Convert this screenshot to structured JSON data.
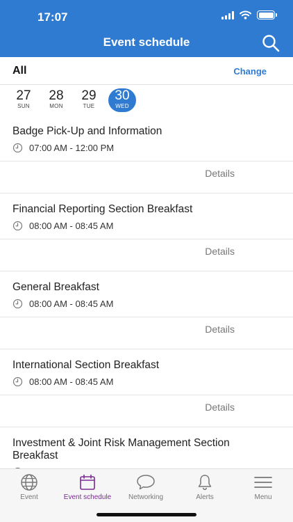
{
  "status_bar": {
    "time": "17:07"
  },
  "header": {
    "title": "Event schedule"
  },
  "filter": {
    "label": "All",
    "change_label": "Change"
  },
  "dates": [
    {
      "num": "27",
      "dow": "SUN"
    },
    {
      "num": "28",
      "dow": "MON"
    },
    {
      "num": "29",
      "dow": "TUE"
    },
    {
      "num": "30",
      "dow": "WED",
      "selected": true
    }
  ],
  "events": [
    {
      "title": "Badge Pick-Up and Information",
      "time": "07:00 AM - 12:00 PM",
      "details_label": "Details"
    },
    {
      "title": "Financial Reporting Section Breakfast",
      "time": "08:00 AM - 08:45 AM",
      "details_label": "Details"
    },
    {
      "title": "General Breakfast",
      "time": "08:00 AM - 08:45 AM",
      "details_label": "Details"
    },
    {
      "title": "International Section Breakfast",
      "time": "08:00 AM - 08:45 AM",
      "details_label": "Details"
    },
    {
      "title": "Investment & Joint Risk Management Section Breakfast",
      "time": ""
    }
  ],
  "tabs": [
    {
      "label": "Event",
      "icon": "globe-icon"
    },
    {
      "label": "Event schedule",
      "icon": "calendar-icon",
      "active": true
    },
    {
      "label": "Networking",
      "icon": "chat-bubble-icon"
    },
    {
      "label": "Alerts",
      "icon": "bell-icon"
    },
    {
      "label": "Menu",
      "icon": "hamburger-icon"
    }
  ],
  "colors": {
    "accent": "#2f7bd1",
    "active_tab": "#7a2a93"
  }
}
